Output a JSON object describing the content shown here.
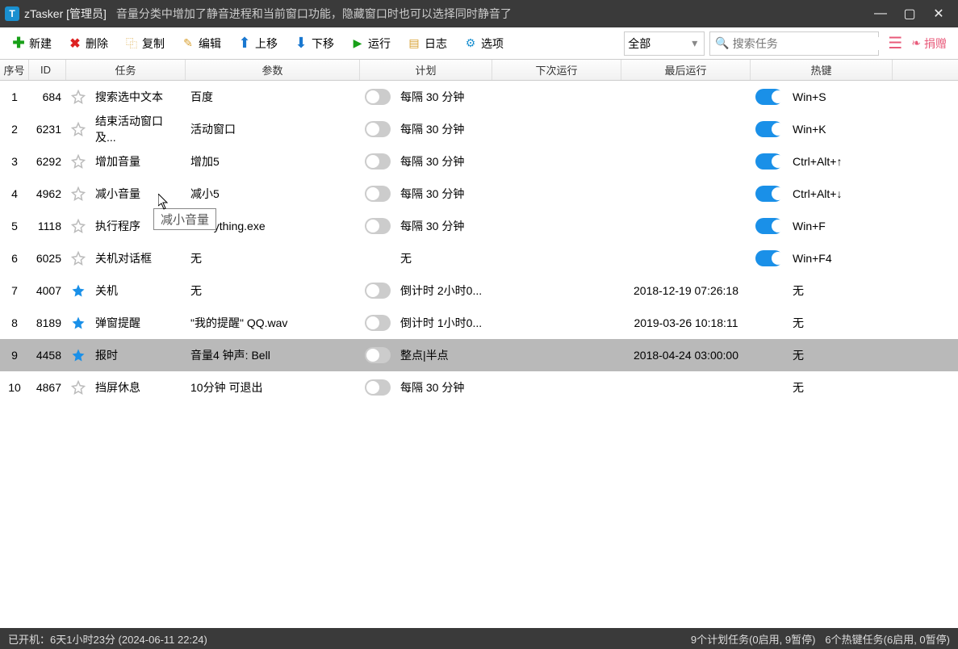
{
  "titlebar": {
    "app": "zTasker [管理员]",
    "subtitle": "音量分类中增加了静音进程和当前窗口功能，隐藏窗口时也可以选择同时静音了"
  },
  "toolbar": {
    "new": "新建",
    "delete": "删除",
    "copy": "复制",
    "edit": "编辑",
    "up": "上移",
    "down": "下移",
    "run": "运行",
    "log": "日志",
    "option": "选项",
    "filter": "全部",
    "search_placeholder": "搜索任务",
    "donate": "捐赠"
  },
  "columns": {
    "seq": "序号",
    "id": "ID",
    "task": "任务",
    "param": "参数",
    "plan": "计划",
    "next": "下次运行",
    "last": "最后运行",
    "hotkey": "热键"
  },
  "rows": [
    {
      "seq": "1",
      "id": "684",
      "star": false,
      "task": "搜索选中文本",
      "param": "百度",
      "plan_on": false,
      "plan": "每隔 30 分钟",
      "next": "",
      "last": "",
      "enable": true,
      "hotkey": "Win+S"
    },
    {
      "seq": "2",
      "id": "6231",
      "star": false,
      "task": "结束活动窗口及...",
      "param": "活动窗口",
      "plan_on": false,
      "plan": "每隔 30 分钟",
      "next": "",
      "last": "",
      "enable": true,
      "hotkey": "Win+K"
    },
    {
      "seq": "3",
      "id": "6292",
      "star": false,
      "task": "增加音量",
      "param": "增加5",
      "plan_on": false,
      "plan": "每隔 30 分钟",
      "next": "",
      "last": "",
      "enable": true,
      "hotkey": "Ctrl+Alt+↑"
    },
    {
      "seq": "4",
      "id": "4962",
      "star": false,
      "task": "减小音量",
      "param": "减小5",
      "plan_on": false,
      "plan": "每隔 30 分钟",
      "next": "",
      "last": "",
      "enable": true,
      "hotkey": "Ctrl+Alt+↓"
    },
    {
      "seq": "5",
      "id": "1118",
      "star": false,
      "task": "执行程序",
      "param": "Everything.exe",
      "plan_on": false,
      "plan": "每隔 30 分钟",
      "next": "",
      "last": "",
      "enable": true,
      "hotkey": "Win+F"
    },
    {
      "seq": "6",
      "id": "6025",
      "star": false,
      "task": "关机对话框",
      "param": "无",
      "plan_on": false,
      "plan": "无",
      "next": "",
      "last": "",
      "enable": true,
      "hotkey": "Win+F4",
      "no_toggle": true
    },
    {
      "seq": "7",
      "id": "4007",
      "star": true,
      "task": "关机",
      "param": "无",
      "plan_on": false,
      "plan": "倒计时 2小时0...",
      "next": "",
      "last": "2018-12-19 07:26:18",
      "enable": false,
      "hotkey": "无",
      "no_enable": true
    },
    {
      "seq": "8",
      "id": "8189",
      "star": true,
      "task": "弹窗提醒",
      "param": "\"我的提醒\" QQ.wav",
      "plan_on": false,
      "plan": "倒计时 1小时0...",
      "next": "",
      "last": "2019-03-26 10:18:11",
      "enable": false,
      "hotkey": "无",
      "no_enable": true
    },
    {
      "seq": "9",
      "id": "4458",
      "star": true,
      "task": "报时",
      "param": "音量4 钟声: Bell",
      "plan_on": false,
      "plan": "整点|半点",
      "next": "",
      "last": "2018-04-24 03:00:00",
      "enable": false,
      "hotkey": "无",
      "selected": true,
      "no_enable": true
    },
    {
      "seq": "10",
      "id": "4867",
      "star": false,
      "task": "挡屏休息",
      "param": "10分钟 可退出",
      "plan_on": false,
      "plan": "每隔 30 分钟",
      "next": "",
      "last": "",
      "enable": false,
      "hotkey": "无",
      "no_enable": true
    }
  ],
  "tooltip": "减小音量",
  "status": {
    "uptime": "已开机：6天1小时23分 (2024-06-11 22:24)",
    "right1": "9个计划任务(0启用, 9暂停)",
    "right2": "6个热键任务(6启用, 0暂停)"
  }
}
